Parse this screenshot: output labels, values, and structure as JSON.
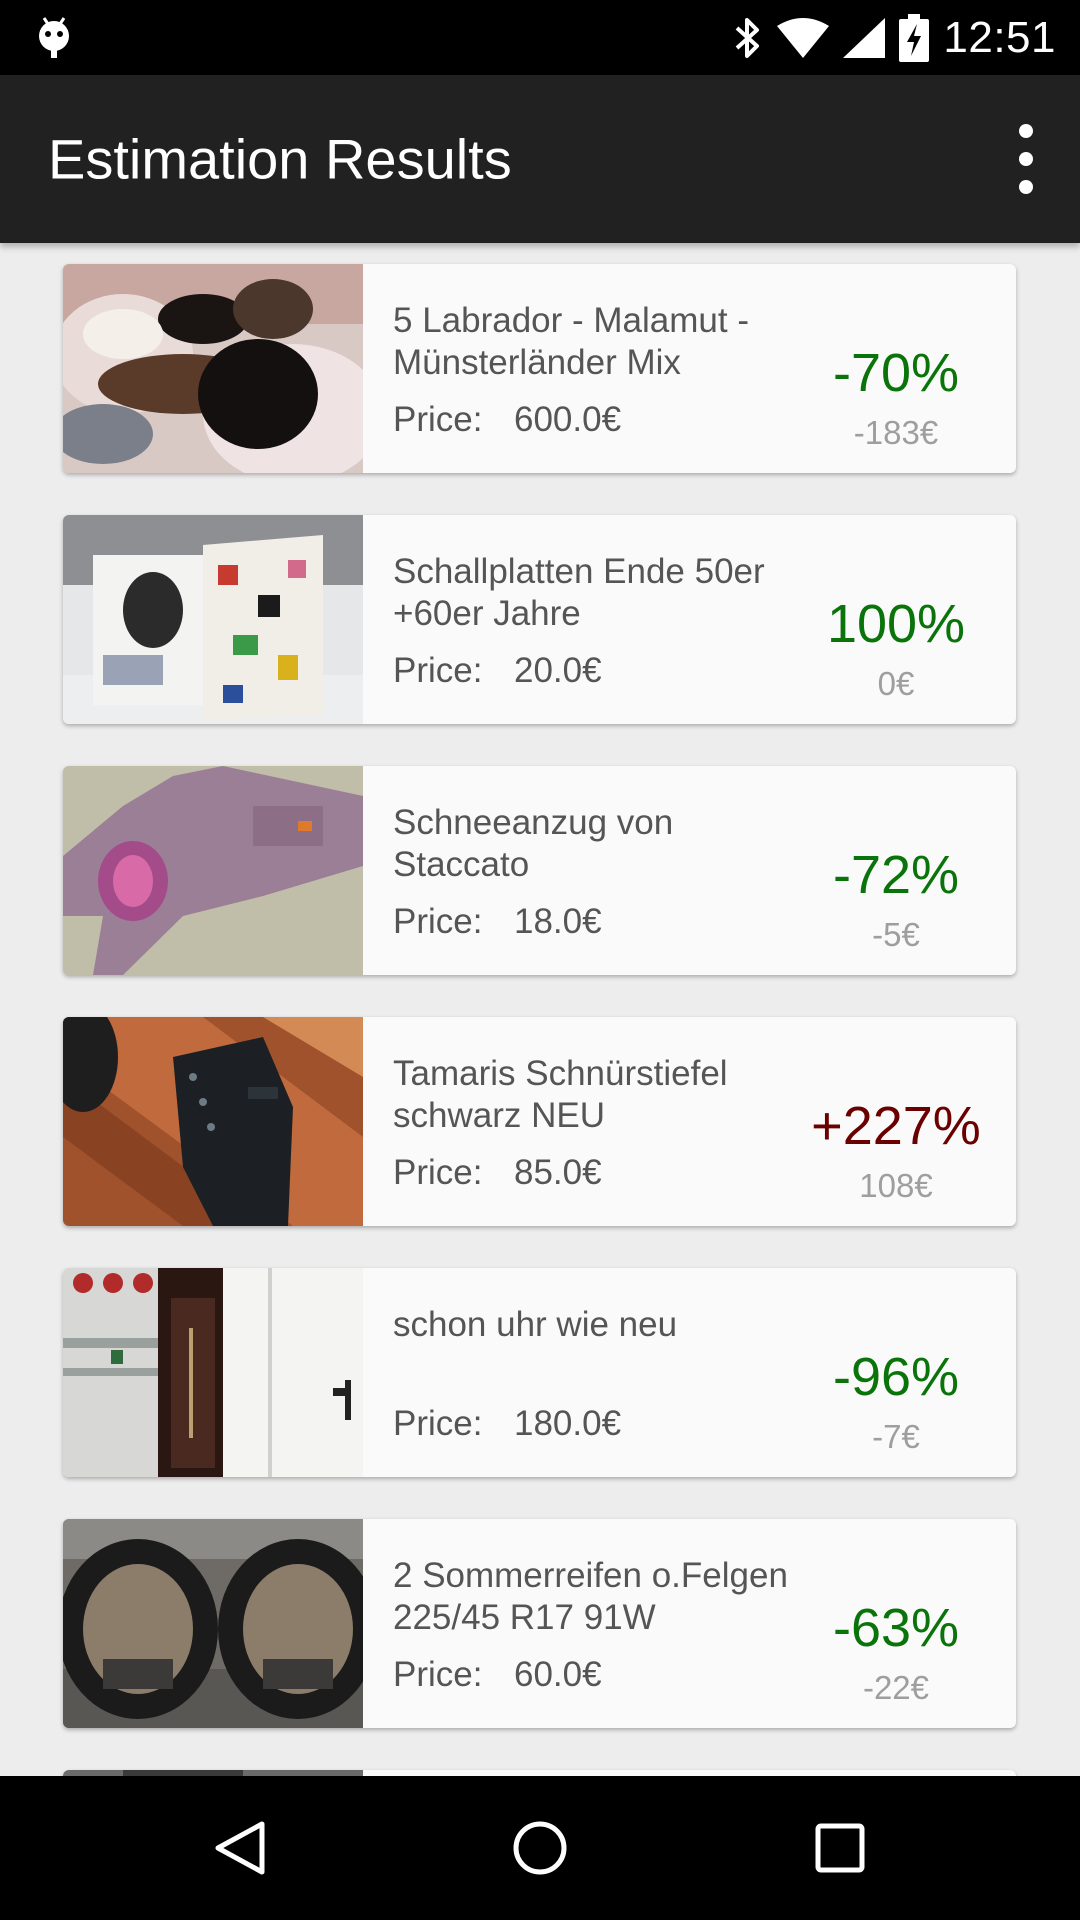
{
  "status_bar": {
    "time": "12:51",
    "icons": [
      "android-debug-icon",
      "bluetooth-icon",
      "wifi-icon",
      "signal-icon",
      "battery-charging-icon"
    ]
  },
  "app_bar": {
    "title": "Estimation Results",
    "overflow_icon": "more-vert-icon"
  },
  "results": [
    {
      "name": "5 Labrador - Malamut - Münsterländer Mix",
      "price_label": "Price:",
      "price": "600.0€",
      "percent": "-70%",
      "delta": "-183€",
      "trend": "down",
      "image": "puppies"
    },
    {
      "name": "Schallplatten Ende 50er +60er Jahre",
      "price_label": "Price:",
      "price": "20.0€",
      "percent": "100%",
      "delta": "0€",
      "trend": "down",
      "image": "records"
    },
    {
      "name": "Schneeanzug von Staccato",
      "price_label": "Price:",
      "price": "18.0€",
      "percent": "-72%",
      "delta": "-5€",
      "trend": "down",
      "image": "snowsuit"
    },
    {
      "name": "Tamaris Schnürstiefel schwarz NEU",
      "price_label": "Price:",
      "price": "85.0€",
      "percent": "+227%",
      "delta": "108€",
      "trend": "up",
      "image": "boots"
    },
    {
      "name": "schon uhr wie neu",
      "price_label": "Price:",
      "price": "180.0€",
      "percent": "-96%",
      "delta": "-7€",
      "trend": "down",
      "image": "clock"
    },
    {
      "name": "2 Sommerreifen o.Felgen 225/45 R17 91W",
      "price_label": "Price:",
      "price": "60.0€",
      "percent": "-63%",
      "delta": "-22€",
      "trend": "down",
      "image": "tires"
    }
  ],
  "colors": {
    "negative_percent": "#0a730a",
    "positive_percent": "#6a0000",
    "delta": "#9e9e9e",
    "app_bar": "#212121"
  },
  "nav_bar": {
    "back": "back-triangle-icon",
    "home": "home-circle-icon",
    "recents": "recents-square-icon"
  }
}
